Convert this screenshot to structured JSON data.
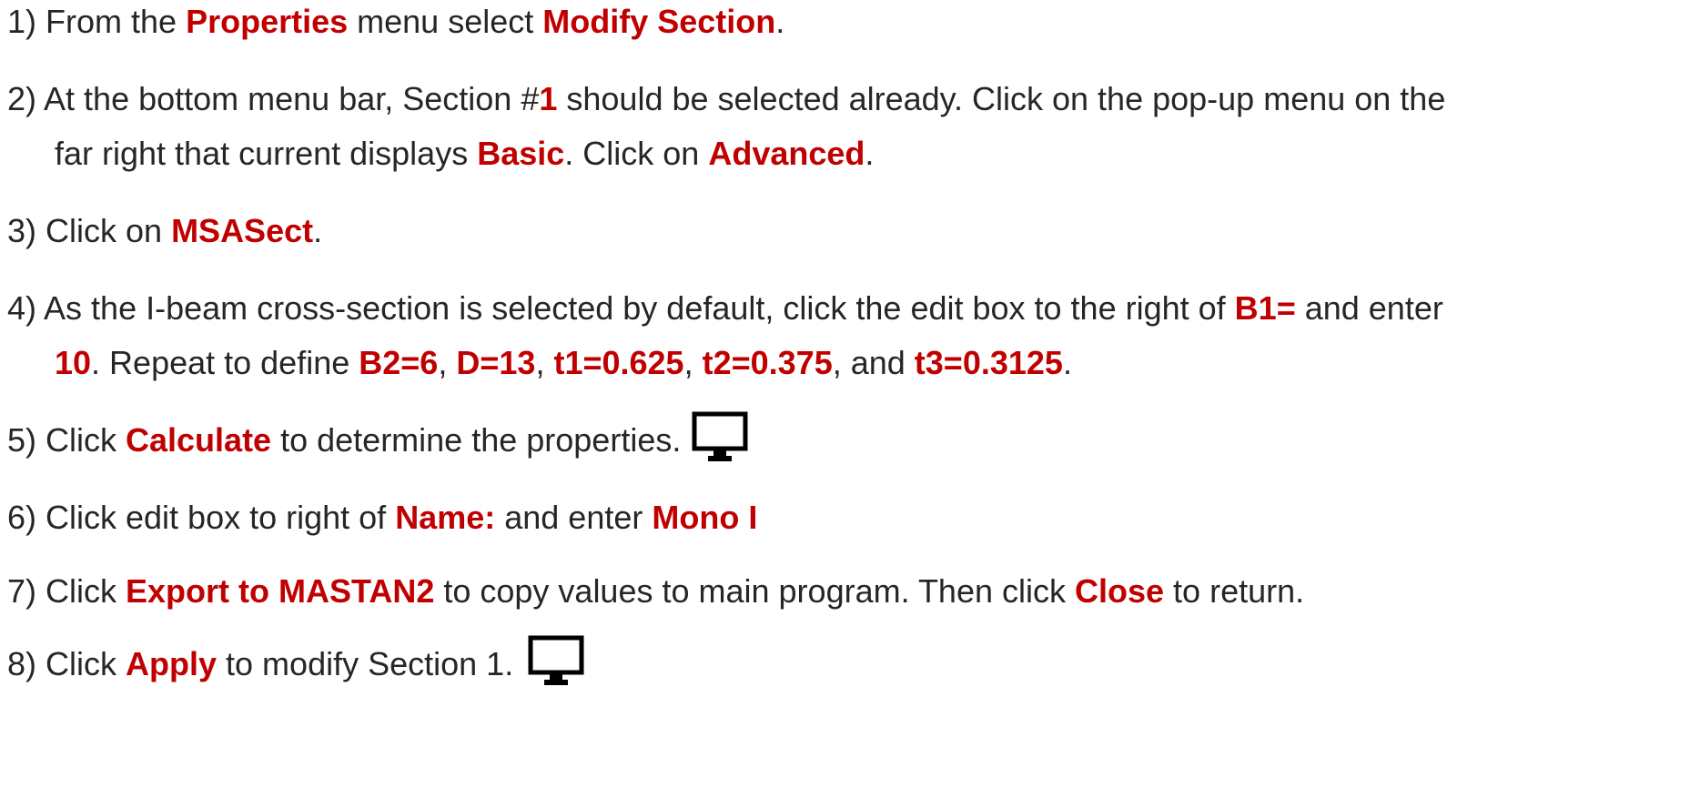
{
  "accent_color": "#c00000",
  "steps": [
    {
      "segments": [
        {
          "text": "1) From the ",
          "hl": false
        },
        {
          "text": "Properties",
          "hl": true
        },
        {
          "text": " menu select ",
          "hl": false
        },
        {
          "text": "Modify Section",
          "hl": true
        },
        {
          "text": ".",
          "hl": false
        }
      ]
    },
    {
      "segments": [
        {
          "text": "2) At the bottom menu bar, Section #",
          "hl": false
        },
        {
          "text": "1",
          "hl": true
        },
        {
          "text": " should be selected already. Click on the pop-up menu on the",
          "hl": false
        }
      ]
    },
    {
      "segments": [
        {
          "text": "far right that current displays ",
          "hl": false
        },
        {
          "text": "Basic",
          "hl": true
        },
        {
          "text": ". Click on ",
          "hl": false
        },
        {
          "text": "Advanced",
          "hl": true
        },
        {
          "text": ".",
          "hl": false
        }
      ]
    },
    {
      "segments": [
        {
          "text": "3) Click on ",
          "hl": false
        },
        {
          "text": "MSASect",
          "hl": true
        },
        {
          "text": ".",
          "hl": false
        }
      ]
    },
    {
      "segments": [
        {
          "text": "4) As the I-beam cross-section is selected by default, click the edit box to the right of ",
          "hl": false
        },
        {
          "text": "B1=",
          "hl": true
        },
        {
          "text": " and enter",
          "hl": false
        }
      ]
    },
    {
      "segments": [
        {
          "text": "10",
          "hl": true
        },
        {
          "text": ". Repeat to define ",
          "hl": false
        },
        {
          "text": "B2=6",
          "hl": true
        },
        {
          "text": ", ",
          "hl": false
        },
        {
          "text": "D=13",
          "hl": true
        },
        {
          "text": ", ",
          "hl": false
        },
        {
          "text": "t1=0.625",
          "hl": true
        },
        {
          "text": ", ",
          "hl": false
        },
        {
          "text": "t2=0.375",
          "hl": true
        },
        {
          "text": ", and ",
          "hl": false
        },
        {
          "text": "t3=0.3125",
          "hl": true
        },
        {
          "text": ".",
          "hl": false
        }
      ]
    },
    {
      "segments": [
        {
          "text": "5) Click ",
          "hl": false
        },
        {
          "text": "Calculate",
          "hl": true
        },
        {
          "text": " to determine the properties.",
          "hl": false
        }
      ]
    },
    {
      "segments": [
        {
          "text": "6) Click edit box to right of ",
          "hl": false
        },
        {
          "text": "Name:",
          "hl": true
        },
        {
          "text": " and enter ",
          "hl": false
        },
        {
          "text": "Mono I",
          "hl": true
        }
      ]
    },
    {
      "segments": [
        {
          "text": "7) Click ",
          "hl": false
        },
        {
          "text": "Export to MASTAN2",
          "hl": true
        },
        {
          "text": " to copy values to main program. Then click ",
          "hl": false
        },
        {
          "text": "Close",
          "hl": true
        },
        {
          "text": " to return.",
          "hl": false
        }
      ]
    },
    {
      "segments": [
        {
          "text": "8) Click ",
          "hl": false
        },
        {
          "text": "Apply",
          "hl": true
        },
        {
          "text": " to modify Section 1.",
          "hl": false
        }
      ]
    }
  ],
  "icons": [
    {
      "name": "monitor-icon"
    },
    {
      "name": "monitor-icon"
    }
  ]
}
